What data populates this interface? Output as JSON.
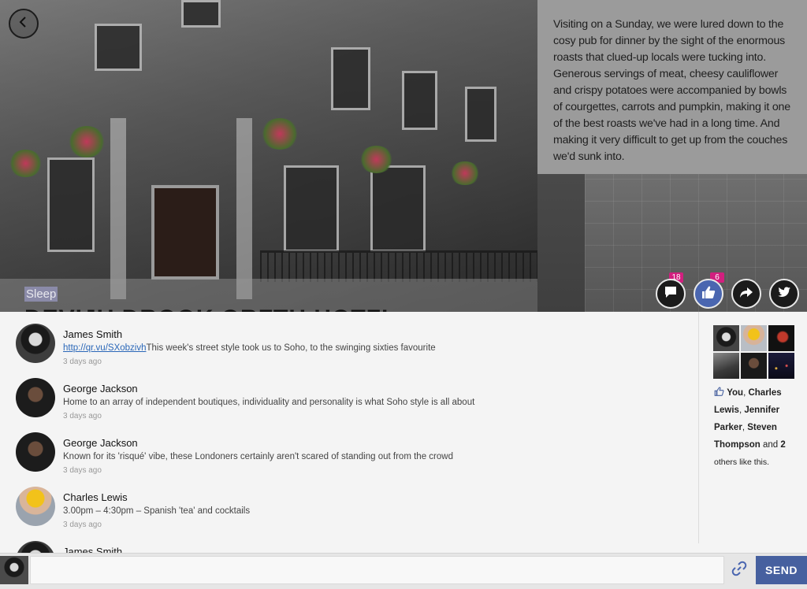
{
  "review": {
    "text": "Visiting on a Sunday, we were lured down to the cosy pub for dinner by the sight of the enormous roasts that clued-up locals were tucking into. Generous servings of meat, cheesy cauliflower and crispy potatoes were accompanied by bowls of courgettes, carrots and pumpkin, making it one of the best roasts we've had in a long time. And making it very difficult to get up from the couches we'd sunk into."
  },
  "header": {
    "category": "Sleep",
    "title": "DEVIJU DROOK ORFTH HOTFI"
  },
  "actions": {
    "comment_count": "18",
    "like_count": "6",
    "comment_icon": "comment-icon",
    "like_icon": "thumbs-up-icon",
    "share_icon": "share-icon",
    "twitter_icon": "twitter-icon"
  },
  "comments": [
    {
      "name": "James Smith",
      "link": "http://qr.vu/SXobzivh",
      "text": "This week's street style took us to Soho, to the swinging sixties favourite",
      "time": "3 days ago",
      "avatar": "dog"
    },
    {
      "name": "George Jackson",
      "link": "",
      "text": "Home to an array of independent boutiques, individuality and personality is what Soho style is all about",
      "time": "3 days ago",
      "avatar": "dark"
    },
    {
      "name": "George Jackson",
      "link": "",
      "text": "Known for its 'risqué' vibe, these Londoners certainly aren't scared of standing out from the crowd",
      "time": "3 days ago",
      "avatar": "dark"
    },
    {
      "name": "Charles Lewis",
      "link": "",
      "text": "3.00pm – 4:30pm – Spanish 'tea' and cocktails",
      "time": "3 days ago",
      "avatar": "helmet"
    },
    {
      "name": "James Smith",
      "link": "",
      "text": "",
      "time": "",
      "avatar": "dog"
    }
  ],
  "likes": {
    "you": "You",
    "names": [
      "Charles Lewis",
      "Jennifer Parker",
      "Steven Thompson"
    ],
    "and": "and",
    "others_count": "2",
    "others_suffix": "others like this."
  },
  "compose": {
    "placeholder": "",
    "send_label": "SEND"
  },
  "colors": {
    "accent": "#46609f",
    "badge": "#d21f7f",
    "link": "#2a67b8"
  }
}
